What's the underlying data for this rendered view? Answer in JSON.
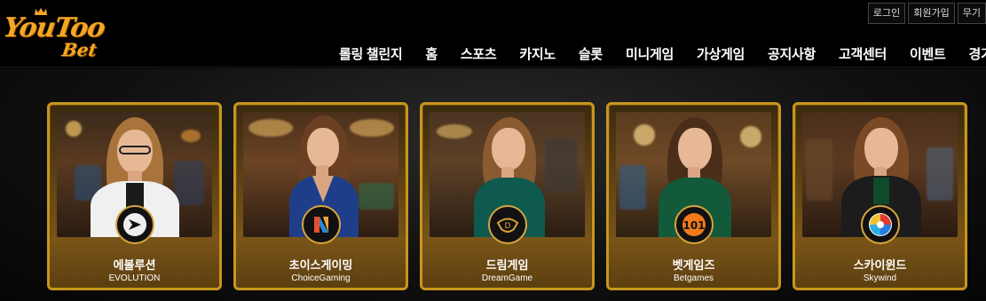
{
  "brand": {
    "line1": "YouToo",
    "line2": "Bet"
  },
  "top_links": [
    "로그인",
    "회원가입",
    "무기"
  ],
  "nav": [
    "롤링 챌린지",
    "홈",
    "스포츠",
    "카지노",
    "슬롯",
    "미니게임",
    "가상게임",
    "공지사항",
    "고객센터",
    "이벤트",
    "경기결"
  ],
  "providers": [
    {
      "name_ko": "에볼루션",
      "name_en": "EVOLUTION",
      "icon": "evolution-icon"
    },
    {
      "name_ko": "초이스게이밍",
      "name_en": "ChoiceGaming",
      "icon": "choicegaming-icon"
    },
    {
      "name_ko": "드림게임",
      "name_en": "DreamGame",
      "icon": "dreamgame-icon"
    },
    {
      "name_ko": "벳게임즈",
      "name_en": "Betgames",
      "icon": "betgames-icon"
    },
    {
      "name_ko": "스카이윈드",
      "name_en": "Skywind",
      "icon": "skywind-icon"
    }
  ],
  "colors": {
    "accent_gold": "#c8961e",
    "logo_orange": "#f5a623",
    "background": "#000000"
  }
}
